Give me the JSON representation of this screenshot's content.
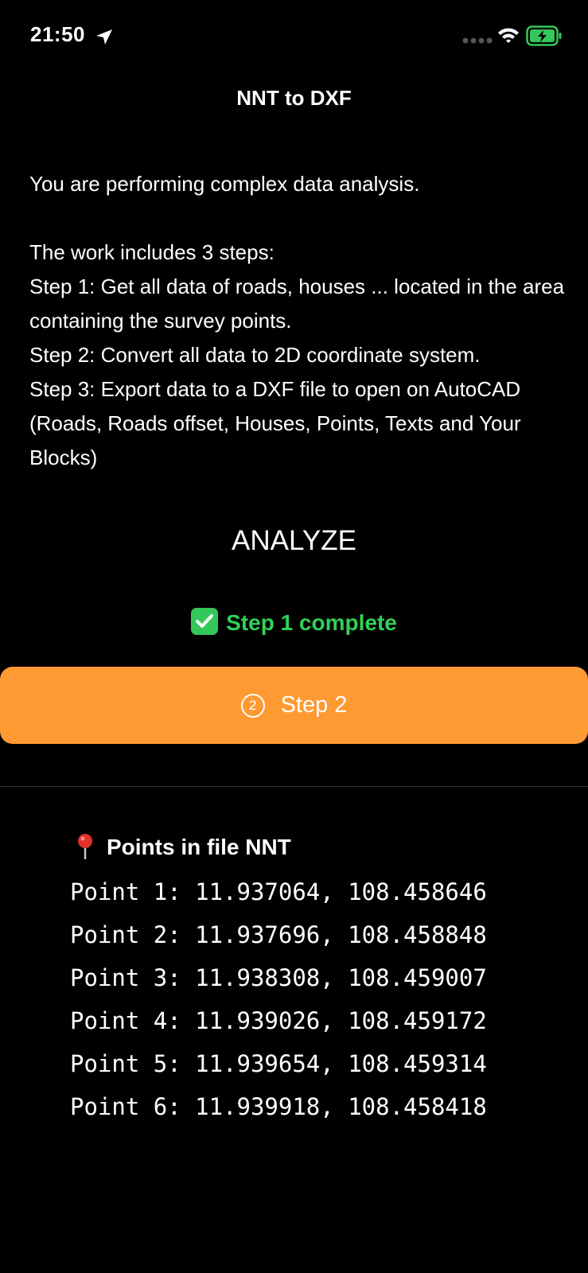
{
  "status_bar": {
    "time": "21:50"
  },
  "nav": {
    "title": "NNT to DXF"
  },
  "description": {
    "intro": "You are performing complex data analysis.",
    "steps_heading": "The work includes 3 steps:",
    "step1": "Step 1: Get all data of roads, houses ... located in the area containing the survey points.",
    "step2": "Step 2: Convert all data to 2D coordinate system.",
    "step3": "Step 3: Export data to a DXF file to open on AutoCAD (Roads, Roads offset, Houses, Points, Texts and Your Blocks)"
  },
  "analyze": {
    "title": "ANALYZE",
    "status": "Step 1 complete",
    "button_number": "2",
    "button_label": "Step 2"
  },
  "points": {
    "header": "Points in file NNT",
    "items": [
      "Point 1: 11.937064, 108.458646",
      "Point 2: 11.937696, 108.458848",
      "Point 3: 11.938308, 108.459007",
      "Point 4: 11.939026, 108.459172",
      "Point 5: 11.939654, 108.459314",
      "Point 6: 11.939918, 108.458418"
    ]
  },
  "colors": {
    "background": "#000000",
    "accent_orange": "#ff9a33",
    "success_green": "#30d158"
  },
  "icons": {
    "location": "location-arrow-icon",
    "signal": "cellular-signal-icon",
    "wifi": "wifi-icon",
    "battery": "battery-charging-icon",
    "check": "checkmark-icon",
    "pin": "map-pin-icon"
  }
}
